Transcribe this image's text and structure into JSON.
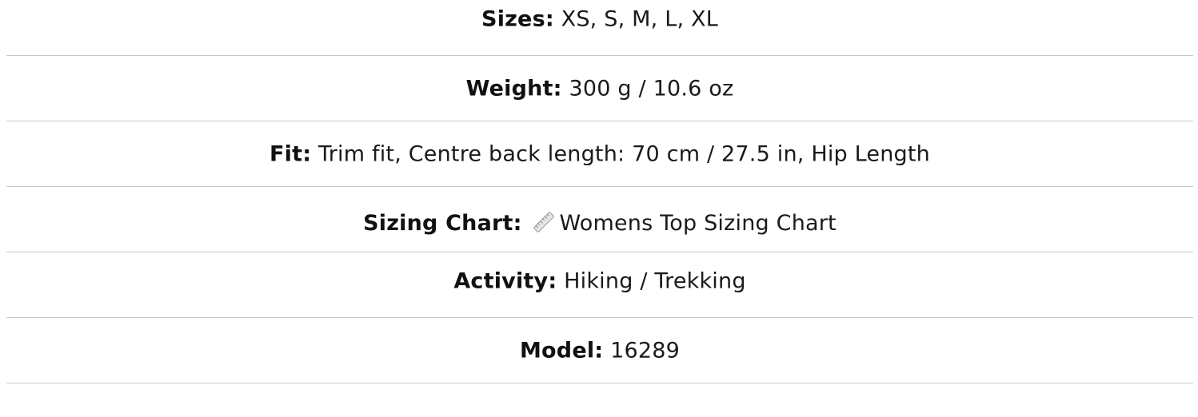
{
  "specs": {
    "sizes": {
      "label": "Sizes:",
      "value": "XS, S, M, L, XL"
    },
    "weight": {
      "label": "Weight:",
      "value": "300 g / 10.6 oz"
    },
    "fit": {
      "label": "Fit:",
      "value": "Trim fit, Centre back length: 70 cm / 27.5 in, Hip Length"
    },
    "sizing_chart": {
      "label": "Sizing Chart:",
      "icon": "ruler-icon",
      "link_text": "Womens Top Sizing Chart"
    },
    "activity": {
      "label": "Activity:",
      "value": "Hiking / Trekking"
    },
    "model": {
      "label": "Model:",
      "value": "16289"
    }
  }
}
